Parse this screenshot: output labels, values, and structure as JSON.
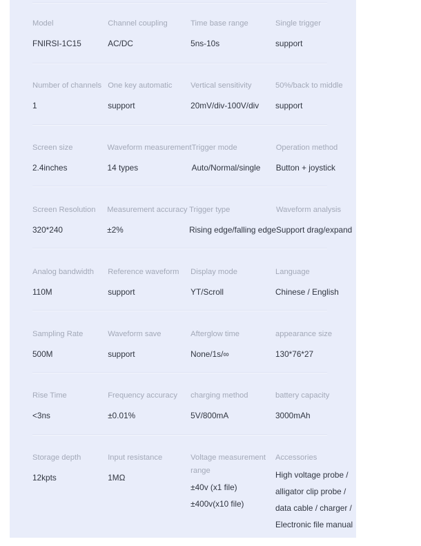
{
  "panel": {
    "background_color": "#e9edfa",
    "page_background_color": "#ffffff",
    "label_color": "#a3a9b8",
    "value_color": "#303540",
    "divider_color": "#dfe4f4"
  },
  "spec_table": {
    "rows": [
      {
        "cells": [
          {
            "label": "Model",
            "value": "FNIRSI-1C15"
          },
          {
            "label": "Channel coupling",
            "value": "AC/DC"
          },
          {
            "label": "Time base range",
            "value": "5ns-10s"
          },
          {
            "label": "Single trigger",
            "value": "support"
          }
        ]
      },
      {
        "cells": [
          {
            "label": "Number of channels",
            "value": "1"
          },
          {
            "label": "One key automatic",
            "value": "support"
          },
          {
            "label": "Vertical sensitivity",
            "value": "20mV/div-100V/div"
          },
          {
            "label": "50%/back to middle",
            "value": "support"
          }
        ]
      },
      {
        "cells": [
          {
            "label": "Screen size",
            "value": "2.4inches"
          },
          {
            "label": "Waveform measurement",
            "value": "14 types"
          },
          {
            "label": "Trigger mode",
            "value": "Auto/Normal/single"
          },
          {
            "label": "Operation method",
            "value": "Button + joystick"
          }
        ]
      },
      {
        "cells": [
          {
            "label": "Screen Resolution",
            "value": "320*240"
          },
          {
            "label": "Measurement accuracy",
            "value": "±2%"
          },
          {
            "label": "Trigger type",
            "value": "Rising edge/falling edge"
          },
          {
            "label": "Waveform analysis",
            "value": "Support drag/expand"
          }
        ]
      },
      {
        "cells": [
          {
            "label": "Analog bandwidth",
            "value": "110M"
          },
          {
            "label": "Reference waveform",
            "value": "support"
          },
          {
            "label": "Display mode",
            "value": "YT/Scroll"
          },
          {
            "label": "Language",
            "value": "Chinese / English"
          }
        ]
      },
      {
        "cells": [
          {
            "label": "Sampling Rate",
            "value": "500M"
          },
          {
            "label": "Waveform save",
            "value": "support"
          },
          {
            "label": "Afterglow time",
            "value": "None/1s/∞"
          },
          {
            "label": "appearance size",
            "value": "130*76*27"
          }
        ]
      },
      {
        "cells": [
          {
            "label": "Rise Time",
            "value": "<3ns"
          },
          {
            "label": "Frequency accuracy",
            "value": "±0.01%"
          },
          {
            "label": "charging method",
            "value": "5V/800mA"
          },
          {
            "label": "battery capacity",
            "value": "3000mAh"
          }
        ]
      },
      {
        "cells": [
          {
            "label": "Storage depth",
            "value": "12kpts"
          },
          {
            "label": "Input resistance",
            "value": "1MΩ"
          },
          {
            "label": "Voltage measurement",
            "label_line2": "range",
            "value_lines": [
              "±40v  (x1 file)",
              "±400v(x10 file)"
            ]
          },
          {
            "label": "Accessories",
            "value_lines": [
              "High voltage probe /",
              "alligator clip probe /",
              "data cable / charger /",
              " Electronic file manual"
            ]
          }
        ]
      }
    ]
  }
}
